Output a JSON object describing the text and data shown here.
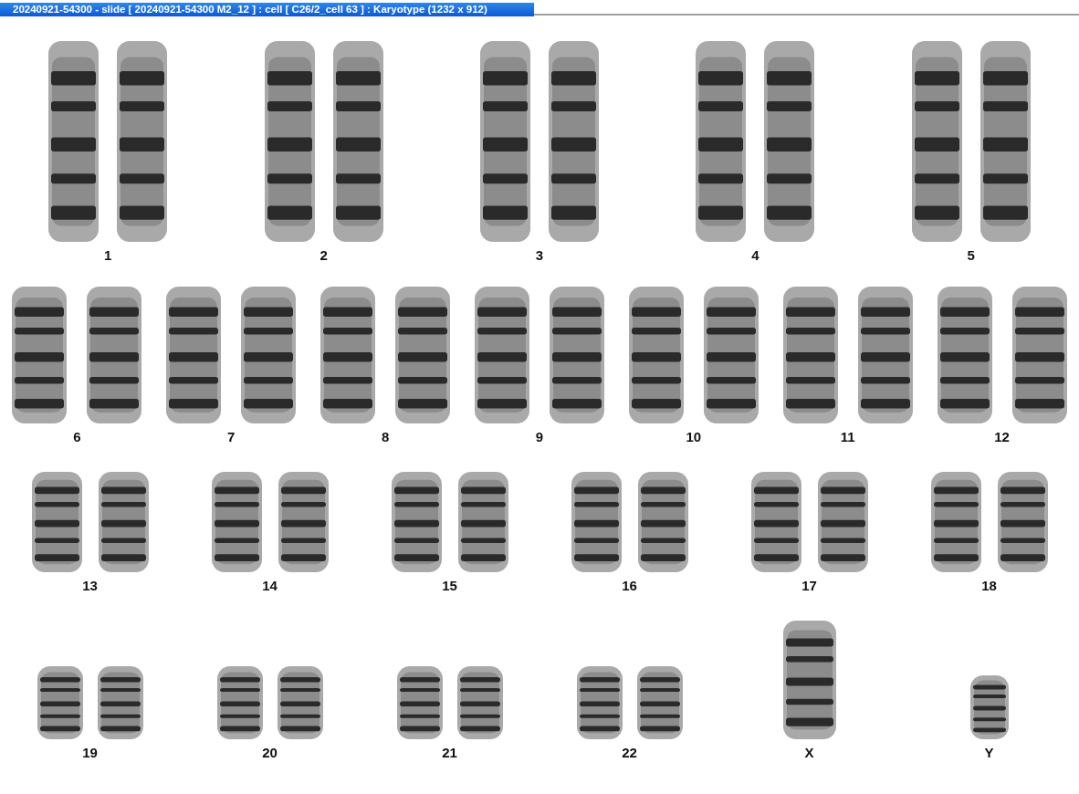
{
  "window": {
    "title": "20240921-54300 - slide [ 20240921-54300 M2_12 ] : cell [ C26/2_cell 63 ] : Karyotype  (1232 x 912)"
  },
  "karyotype": {
    "rows": [
      {
        "items": [
          {
            "label": "1",
            "kind": "pair"
          },
          {
            "label": "2",
            "kind": "pair"
          },
          {
            "label": "3",
            "kind": "pair"
          },
          {
            "label": "4",
            "kind": "pair"
          },
          {
            "label": "5",
            "kind": "pair"
          }
        ]
      },
      {
        "items": [
          {
            "label": "6",
            "kind": "pair"
          },
          {
            "label": "7",
            "kind": "pair"
          },
          {
            "label": "8",
            "kind": "pair"
          },
          {
            "label": "9",
            "kind": "pair"
          },
          {
            "label": "10",
            "kind": "pair"
          },
          {
            "label": "11",
            "kind": "pair"
          },
          {
            "label": "12",
            "kind": "pair"
          }
        ]
      },
      {
        "items": [
          {
            "label": "13",
            "kind": "pair"
          },
          {
            "label": "14",
            "kind": "pair"
          },
          {
            "label": "15",
            "kind": "pair"
          },
          {
            "label": "16",
            "kind": "pair"
          },
          {
            "label": "17",
            "kind": "pair"
          },
          {
            "label": "18",
            "kind": "pair"
          }
        ]
      },
      {
        "items": [
          {
            "label": "19",
            "kind": "pair"
          },
          {
            "label": "20",
            "kind": "pair"
          },
          {
            "label": "21",
            "kind": "pair"
          },
          {
            "label": "22",
            "kind": "pair"
          },
          {
            "label": "X",
            "kind": "single-tall"
          },
          {
            "label": "Y",
            "kind": "single-short"
          }
        ]
      }
    ]
  }
}
